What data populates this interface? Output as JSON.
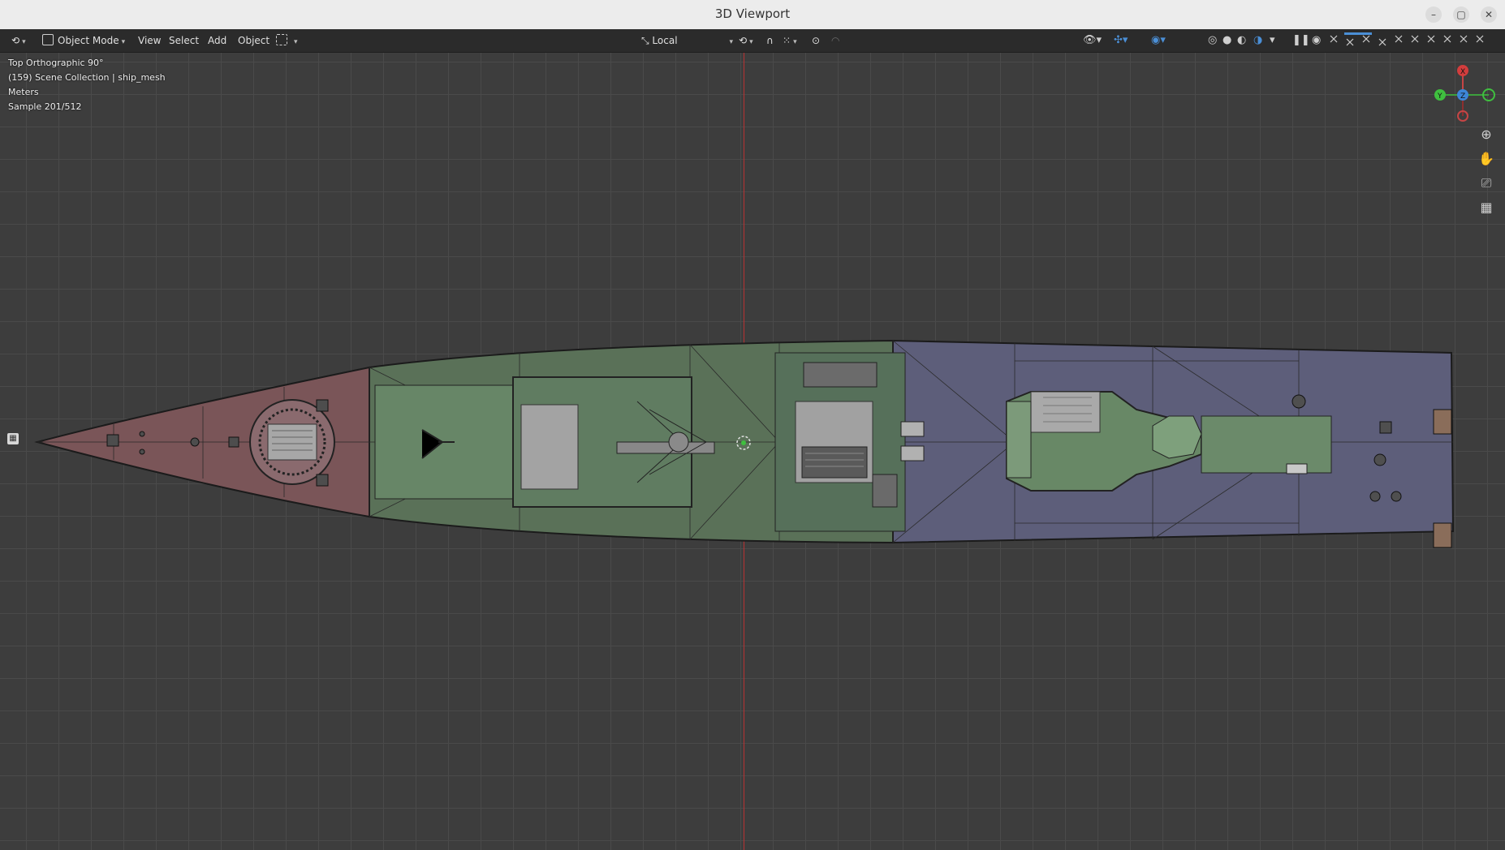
{
  "window": {
    "title": "3D Viewport",
    "minimize": "–",
    "maximize": "▢",
    "close": "✕"
  },
  "header": {
    "editor_type_icon": "⟲",
    "mode_label": "Object Mode",
    "menus": [
      "View",
      "Select",
      "Add",
      "Object"
    ],
    "pivot_label": "Local",
    "shading_icons": [
      "◎",
      "●",
      "◐",
      "◑"
    ]
  },
  "overlay": {
    "view_name": "Top Orthographic 90°",
    "collection": "(159) Scene Collection | ship_mesh",
    "units": "Meters",
    "sample": "Sample 201/512"
  },
  "gizmo": {
    "x": "X",
    "y": "Y",
    "z": "Z"
  },
  "nav": {
    "zoom_icon": "⊕",
    "pan_icon": "✋",
    "camera_icon": "⎚",
    "grid_icon": "▦"
  },
  "colors": {
    "bow": "#7a5558",
    "mid": "#5a7158",
    "stern": "#5d5e7a",
    "axis_red": "#b83232",
    "accent": "#4b8fd6"
  }
}
